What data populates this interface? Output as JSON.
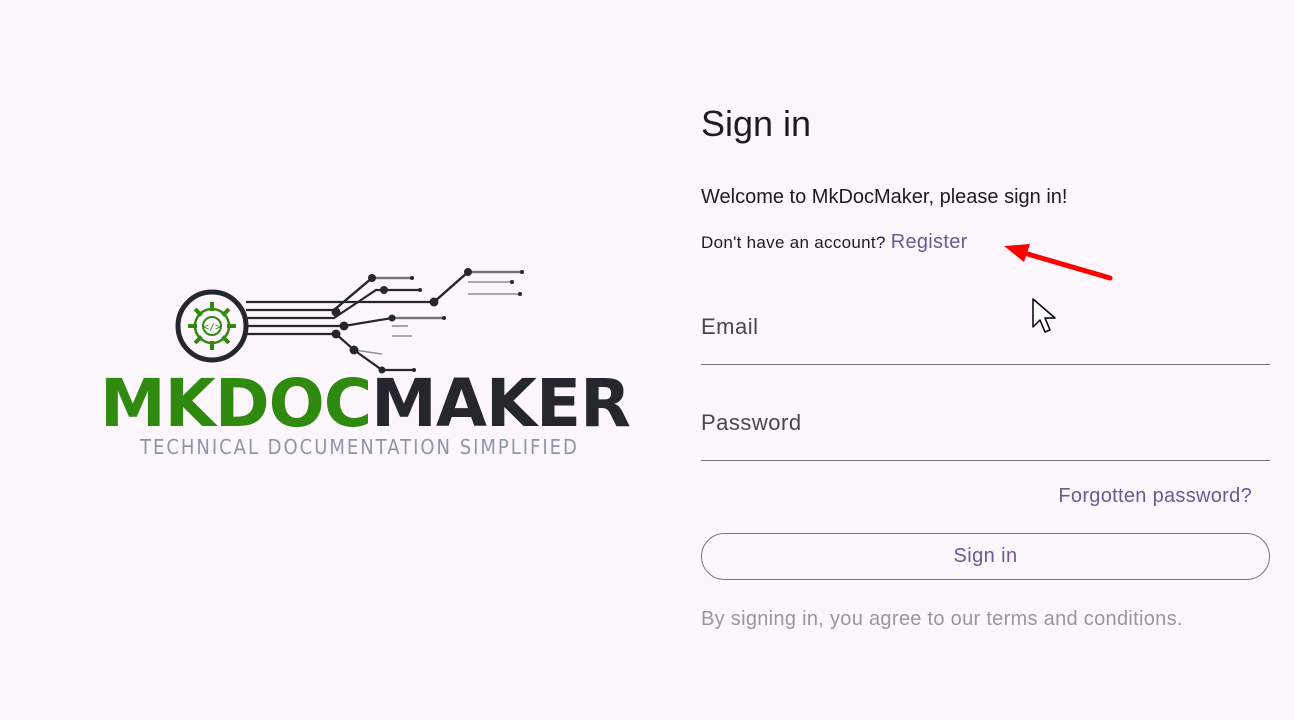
{
  "logo": {
    "word_part1": "MKDOC",
    "word_part2": "MAKER",
    "tagline": "TECHNICAL DOCUMENTATION SIMPLIFIED",
    "colors": {
      "green": "#2f8a0f",
      "dark": "#26272e",
      "tagline": "#8d97a3"
    }
  },
  "signin": {
    "title": "Sign in",
    "welcome": "Welcome to MkDocMaker, please sign in!",
    "no_account_text": "Don't have an account? ",
    "register_link": "Register",
    "email_label": "Email",
    "password_label": "Password",
    "forgot_link": "Forgotten password?",
    "submit_label": "Sign in",
    "terms": "By signing in, you agree to our terms and conditions."
  },
  "colors": {
    "background": "#fdf7fd",
    "accent": "#6a5a92",
    "annotation_arrow": "#ff0000"
  },
  "icons": [
    "gear-code-icon",
    "red-arrow-annotation",
    "mouse-pointer-icon"
  ]
}
